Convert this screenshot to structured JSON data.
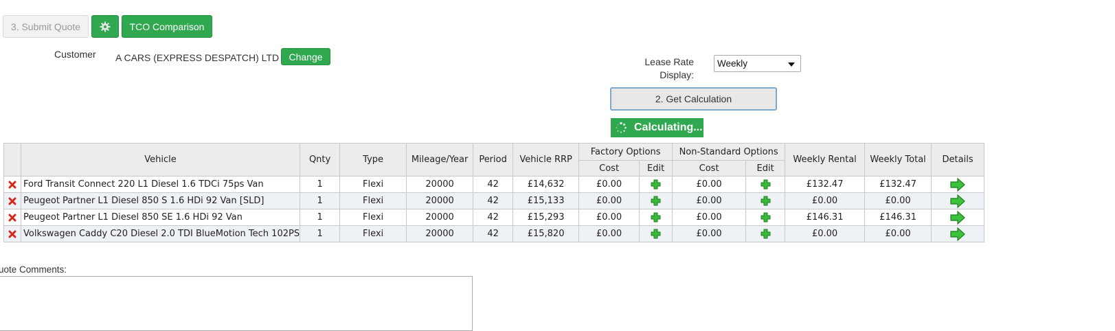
{
  "toolbar": {
    "submit_quote_label": "3. Submit Quote",
    "settings_icon": "gear-icon",
    "tco_label": "TCO Comparison"
  },
  "customer": {
    "label": "Customer",
    "name": "A CARS (EXPRESS DESPATCH) LTD -",
    "change_label": "Change"
  },
  "lease_rate": {
    "label_line1": "Lease Rate",
    "label_line2": "Display:",
    "selected": "Weekly"
  },
  "calculation": {
    "button_label": "2. Get Calculation",
    "status": "Calculating..."
  },
  "table": {
    "headers": {
      "vehicle": "Vehicle",
      "qnty": "Qnty",
      "type": "Type",
      "mileage": "Mileage/Year",
      "period": "Period",
      "rrp": "Vehicle RRP",
      "factory_options": "Factory Options",
      "non_standard_options": "Non-Standard Options",
      "cost": "Cost",
      "edit": "Edit",
      "weekly_rental": "Weekly Rental",
      "weekly_total": "Weekly Total",
      "details": "Details"
    },
    "rows": [
      {
        "vehicle": "Ford Transit Connect 220 L1 Diesel 1.6 TDCi 75ps Van",
        "qnty": "1",
        "type": "Flexi",
        "mileage": "20000",
        "period": "42",
        "rrp": "£14,632",
        "factory_cost": "£0.00",
        "nonstd_cost": "£0.00",
        "weekly_rental": "£132.47",
        "weekly_total": "£132.47"
      },
      {
        "vehicle": "Peugeot Partner L1 Diesel 850 S 1.6 HDi 92 Van [SLD]",
        "qnty": "1",
        "type": "Flexi",
        "mileage": "20000",
        "period": "42",
        "rrp": "£15,133",
        "factory_cost": "£0.00",
        "nonstd_cost": "£0.00",
        "weekly_rental": "£0.00",
        "weekly_total": "£0.00"
      },
      {
        "vehicle": "Peugeot Partner L1 Diesel 850 SE 1.6 HDi 92 Van",
        "qnty": "1",
        "type": "Flexi",
        "mileage": "20000",
        "period": "42",
        "rrp": "£15,293",
        "factory_cost": "£0.00",
        "nonstd_cost": "£0.00",
        "weekly_rental": "£146.31",
        "weekly_total": "£146.31"
      },
      {
        "vehicle": "Volkswagen Caddy C20 Diesel 2.0 TDI BlueMotion Tech 102PS",
        "qnty": "1",
        "type": "Flexi",
        "mileage": "20000",
        "period": "42",
        "rrp": "£15,820",
        "factory_cost": "£0.00",
        "nonstd_cost": "£0.00",
        "weekly_rental": "£0.00",
        "weekly_total": "£0.00"
      }
    ]
  },
  "comments": {
    "label": "uote Comments:",
    "value": ""
  },
  "colors": {
    "accent_green": "#2fa84f",
    "delete_red": "#d9261c",
    "header_bg": "#ececec",
    "alt_row_bg": "#eef1f6"
  }
}
